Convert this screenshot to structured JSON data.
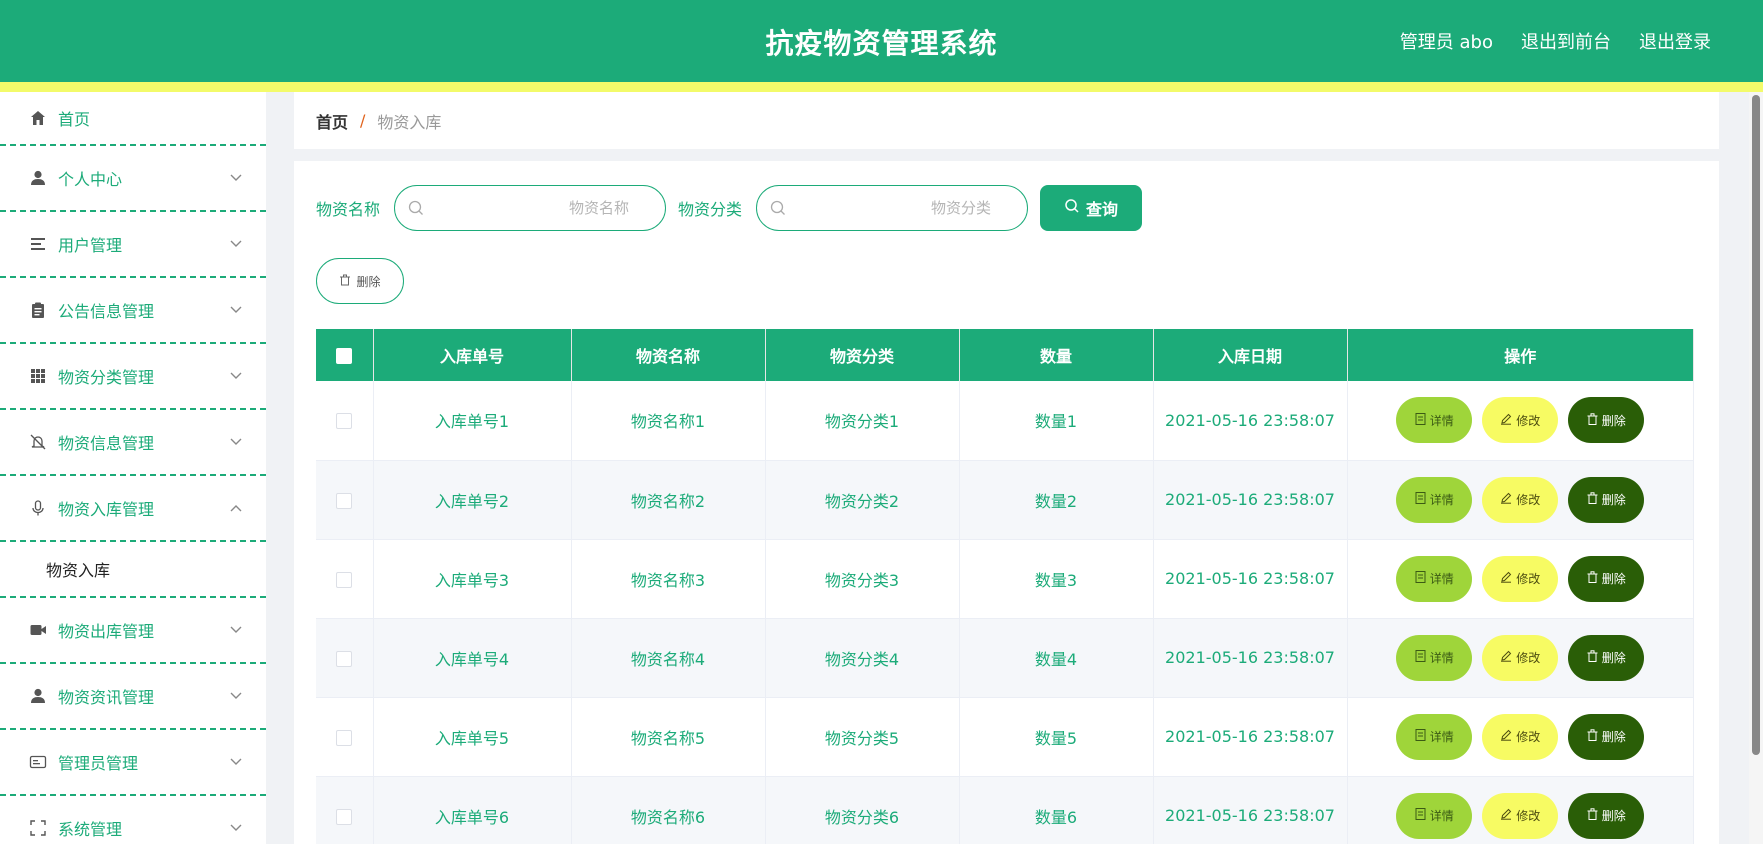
{
  "header": {
    "title": "抗疫物资管理系统",
    "user": "管理员 abo",
    "front_link": "退出到前台",
    "logout": "退出登录"
  },
  "sidebar": {
    "items": [
      {
        "label": "首页",
        "icon": "home-icon"
      },
      {
        "label": "个人中心",
        "icon": "user-icon"
      },
      {
        "label": "用户管理",
        "icon": "list-icon"
      },
      {
        "label": "公告信息管理",
        "icon": "clipboard-icon"
      },
      {
        "label": "物资分类管理",
        "icon": "grid-icon"
      },
      {
        "label": "物资信息管理",
        "icon": "bell-off-icon"
      },
      {
        "label": "物资入库管理",
        "icon": "microphone-icon"
      },
      {
        "label": "物资出库管理",
        "icon": "video-icon"
      },
      {
        "label": "物资资讯管理",
        "icon": "user-icon"
      },
      {
        "label": "管理员管理",
        "icon": "id-card-icon"
      },
      {
        "label": "系统管理",
        "icon": "frame-icon"
      }
    ],
    "submenu_label": "物资入库"
  },
  "breadcrumb": {
    "home": "首页",
    "separator": "/",
    "current": "物资入库"
  },
  "search": {
    "name_label": "物资名称",
    "name_placeholder": "物资名称",
    "category_label": "物资分类",
    "category_placeholder": "物资分类",
    "query_label": "查询"
  },
  "toolbar": {
    "delete_label": "删除"
  },
  "table": {
    "columns": [
      "入库单号",
      "物资名称",
      "物资分类",
      "数量",
      "入库日期",
      "操作"
    ],
    "rows": [
      {
        "no": "入库单号1",
        "name": "物资名称1",
        "category": "物资分类1",
        "qty": "数量1",
        "date": "2021-05-16 23:58:07"
      },
      {
        "no": "入库单号2",
        "name": "物资名称2",
        "category": "物资分类2",
        "qty": "数量2",
        "date": "2021-05-16 23:58:07"
      },
      {
        "no": "入库单号3",
        "name": "物资名称3",
        "category": "物资分类3",
        "qty": "数量3",
        "date": "2021-05-16 23:58:07"
      },
      {
        "no": "入库单号4",
        "name": "物资名称4",
        "category": "物资分类4",
        "qty": "数量4",
        "date": "2021-05-16 23:58:07"
      },
      {
        "no": "入库单号5",
        "name": "物资名称5",
        "category": "物资分类5",
        "qty": "数量5",
        "date": "2021-05-16 23:58:07"
      },
      {
        "no": "入库单号6",
        "name": "物资名称6",
        "category": "物资分类6",
        "qty": "数量6",
        "date": "2021-05-16 23:58:07"
      }
    ],
    "actions": {
      "detail": "详情",
      "edit": "修改",
      "delete": "删除"
    }
  },
  "colors": {
    "primary": "#1cab79",
    "accent_stripe": "#f3fb6a",
    "detail_btn": "#9fd53a",
    "edit_btn": "#f7fb63",
    "delete_btn": "#2a5e07"
  }
}
